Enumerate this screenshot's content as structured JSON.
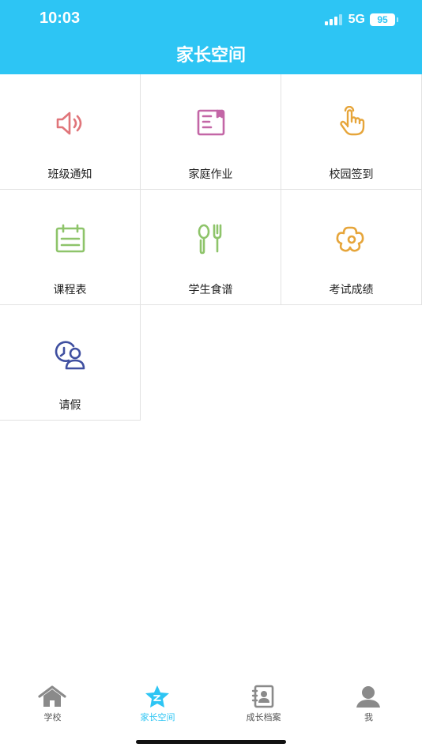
{
  "status_bar": {
    "time": "10:03",
    "network": "5G",
    "battery": "95"
  },
  "header": {
    "title": "家长空间"
  },
  "grid": {
    "items": [
      {
        "label": "班级通知",
        "icon": "speaker-icon",
        "color": "#e0757a"
      },
      {
        "label": "家庭作业",
        "icon": "homework-icon",
        "color": "#c366a6"
      },
      {
        "label": "校园签到",
        "icon": "hand-tap-icon",
        "color": "#e6a53a"
      },
      {
        "label": "课程表",
        "icon": "calendar-icon",
        "color": "#8ec46a"
      },
      {
        "label": "学生食谱",
        "icon": "utensils-icon",
        "color": "#8ec46a"
      },
      {
        "label": "考试成绩",
        "icon": "flower-icon",
        "color": "#e6a53a"
      },
      {
        "label": "请假",
        "icon": "leave-clock-user-icon",
        "color": "#3f4fa0"
      }
    ]
  },
  "tabbar": {
    "active_color": "#2dc5f4",
    "inactive_color": "#8a8a8a",
    "tabs": [
      {
        "label": "学校",
        "icon": "home-icon",
        "active": false
      },
      {
        "label": "家长空间",
        "icon": "star-icon",
        "active": true
      },
      {
        "label": "成长档案",
        "icon": "profile-book-icon",
        "active": false
      },
      {
        "label": "我",
        "icon": "user-icon",
        "active": false
      }
    ]
  }
}
